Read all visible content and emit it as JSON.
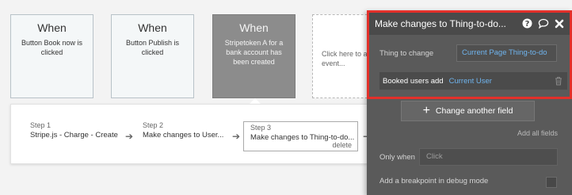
{
  "events": [
    {
      "when": "When",
      "description": "Button Book now is clicked"
    },
    {
      "when": "When",
      "description": "Button Publish is clicked"
    },
    {
      "when": "When",
      "description": "Stripetoken A for a bank account has been created"
    },
    {
      "description": "Click here to a event..."
    }
  ],
  "steps": [
    {
      "number": "Step 1",
      "name": "Stripe.js - Charge - Create"
    },
    {
      "number": "Step 2",
      "name": "Make changes to User..."
    },
    {
      "number": "Step 3",
      "name": "Make changes to Thing-to-do...",
      "delete_label": "delete"
    }
  ],
  "panel": {
    "title": "Make changes to Thing-to-do...",
    "thing_to_change_label": "Thing to change",
    "thing_to_change_value": "Current Page Thing-to-do",
    "field_label": "Booked users add",
    "field_value": "Current User",
    "change_field_button": "Change another field",
    "add_all_fields": "Add all fields",
    "only_when_label": "Only when",
    "only_when_placeholder": "Click",
    "breakpoint_label": "Add a breakpoint in debug mode"
  },
  "colors": {
    "highlight": "#e3302a",
    "dynamic_text": "#6fb4ee",
    "panel_bg": "#5a5a5a"
  }
}
